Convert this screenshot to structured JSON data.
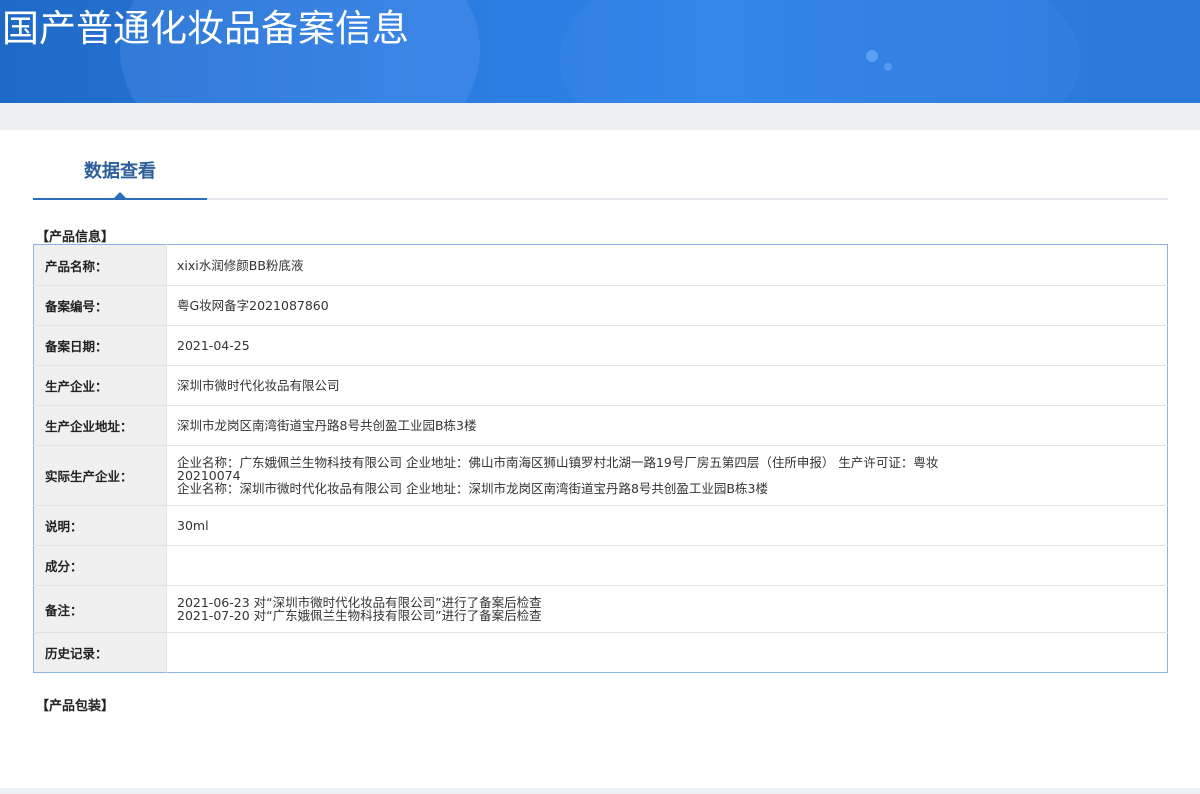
{
  "header": {
    "title": "国产普通化妆品备案信息"
  },
  "tabs": [
    {
      "label": "数据查看"
    }
  ],
  "product_info": {
    "section_title": "【产品信息】",
    "rows": {
      "name": {
        "label": "产品名称：",
        "value": "xixi水润修颜BB粉底液"
      },
      "record_no": {
        "label": "备案编号：",
        "value": "粤G妆网备字2021087860"
      },
      "record_date": {
        "label": "备案日期：",
        "value": "2021-04-25"
      },
      "manufacturer": {
        "label": "生产企业：",
        "value": "深圳市微时代化妆品有限公司"
      },
      "manufacturer_address": {
        "label": "生产企业地址：",
        "value": "深圳市龙岗区南湾街道宝丹路8号共创盈工业园B栋3楼"
      },
      "actual_manufacturer": {
        "label": "实际生产企业：",
        "lines": [
          "企业名称：广东娥佩兰生物科技有限公司 企业地址：佛山市南海区狮山镇罗村北湖一路19号厂房五第四层（住所申报） 生产许可证：粤妆20210074",
          "企业名称：深圳市微时代化妆品有限公司 企业地址：深圳市龙岗区南湾街道宝丹路8号共创盈工业园B栋3楼"
        ]
      },
      "description": {
        "label": "说明：",
        "value": "30ml"
      },
      "ingredients": {
        "label": "成分：",
        "value": ""
      },
      "remarks": {
        "label": "备注：",
        "lines": [
          "2021-06-23 对“深圳市微时代化妆品有限公司”进行了备案后检查",
          "2021-07-20 对“广东娥佩兰生物科技有限公司”进行了备案后检查"
        ]
      },
      "history": {
        "label": "历史记录：",
        "value": ""
      }
    }
  },
  "product_packaging": {
    "section_title": "【产品包装】"
  }
}
